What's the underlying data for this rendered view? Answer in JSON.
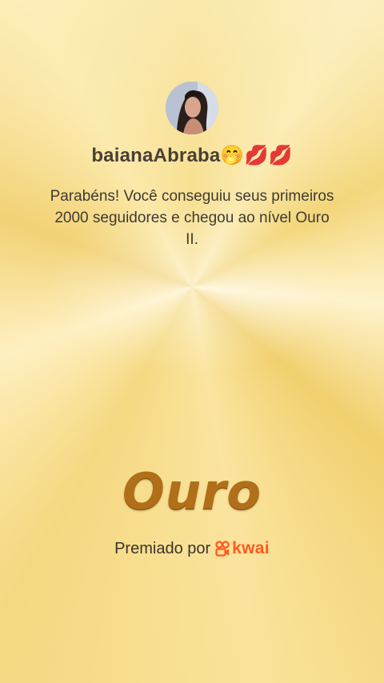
{
  "profile": {
    "username": "baianaAbraba🤭💋💋",
    "avatar_icon": "user-photo"
  },
  "message": "Parabéns! Você conseguiu seus primeiros 2000 seguidores e chegou ao nível Ouro II.",
  "tier": {
    "title": "Ouro",
    "color": "#b06f18"
  },
  "footer": {
    "awarded_by": "Premiado por",
    "brand": "kwai",
    "brand_color": "#ff5a1f",
    "brand_icon": "kwai-logo-icon"
  }
}
